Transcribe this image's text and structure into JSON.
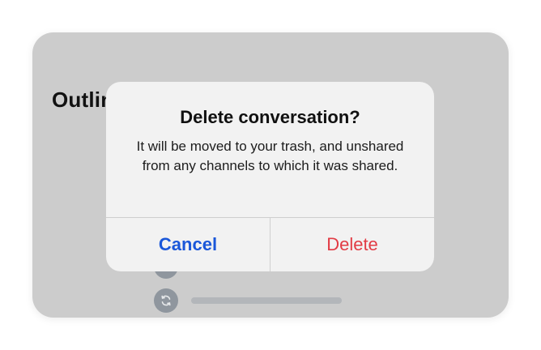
{
  "background": {
    "title": "Outline",
    "rows": [
      {
        "icon": "user-icon"
      },
      {
        "icon": "refresh-icon"
      }
    ]
  },
  "dialog": {
    "title": "Delete conversation?",
    "message": "It will be moved to your trash, and unshared from any channels to which it was shared.",
    "cancel_label": "Cancel",
    "delete_label": "Delete"
  },
  "colors": {
    "cancel": "#1a57d9",
    "delete": "#e23c45",
    "overlay": "#cccccc",
    "dialog_bg": "#f2f2f2"
  }
}
